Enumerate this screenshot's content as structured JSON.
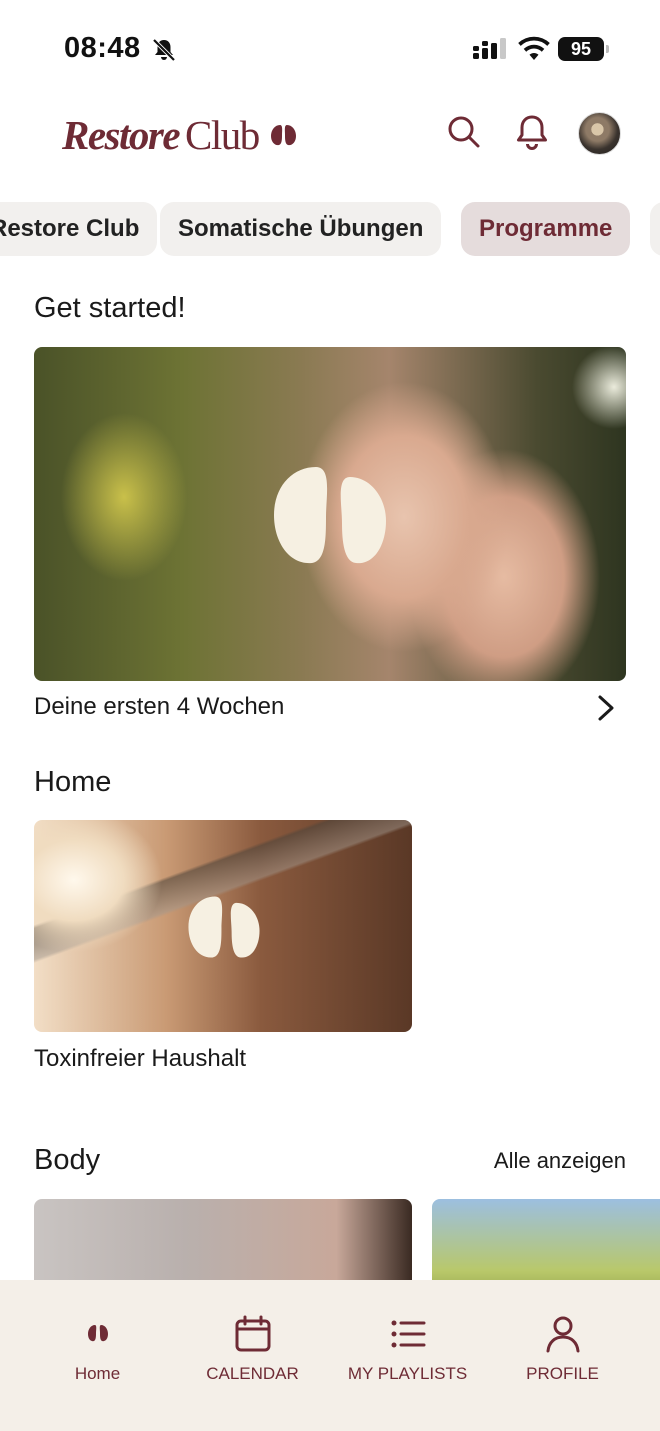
{
  "status_bar": {
    "time": "08:48",
    "battery": "95"
  },
  "header": {
    "logo_restore": "Restore",
    "logo_club": "Club"
  },
  "chips": [
    {
      "label": "Restore Club",
      "active": false
    },
    {
      "label": "Somatische Übungen",
      "active": false
    },
    {
      "label": "Programme",
      "active": true
    }
  ],
  "sections": {
    "get_started": {
      "title": "Get started!",
      "card_label": "Deine ersten 4 Wochen"
    },
    "home": {
      "title": "Home",
      "card_label": "Toxinfreier Haushalt"
    },
    "body": {
      "title": "Body",
      "link": "Alle anzeigen"
    }
  },
  "bottom_nav": {
    "home": "Home",
    "calendar": "CALENDAR",
    "playlists": "MY PLAYLISTS",
    "profile": "PROFILE"
  },
  "colors": {
    "brand": "#6e2b35",
    "nav_bg": "#f4efe8",
    "chip_bg": "#f2f0ee",
    "chip_active_bg": "#e5dcdc"
  }
}
